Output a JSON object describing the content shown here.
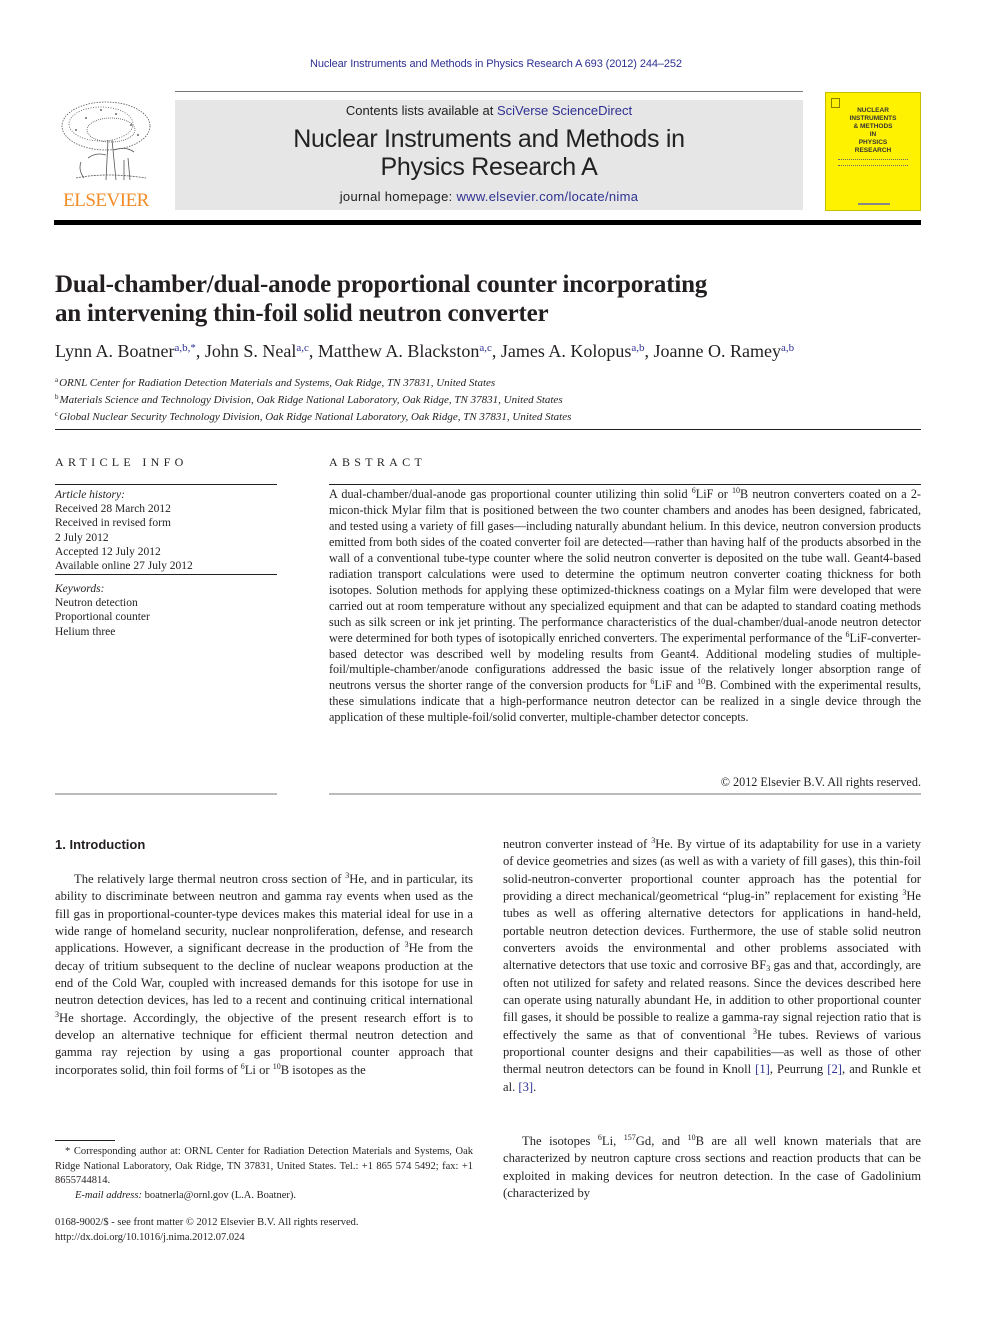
{
  "header": {
    "citation": "Nuclear Instruments and Methods in Physics Research A 693 (2012) 244–252",
    "publisher_logo_text": "ELSEVIER",
    "contents_prefix": "Contents lists available at ",
    "contents_link": "SciVerse ScienceDirect",
    "journal_title": "Nuclear Instruments and Methods in Physics Research A",
    "homepage_prefix": "journal homepage: ",
    "homepage_link": "www.elsevier.com/locate/nima",
    "cover_title": "NUCLEAR\nINSTRUMENTS\n& METHODS\nIN\nPHYSICS\nRESEARCH",
    "colors": {
      "elsevier_orange": "#f28c28",
      "link_blue": "#2e3192",
      "cover_yellow": "#fff200",
      "banner_gray": "#e6e6e6"
    }
  },
  "article": {
    "title_line1": "Dual-chamber/dual-anode proportional counter incorporating",
    "title_line2": "an intervening thin-foil solid neutron converter",
    "authors": [
      {
        "name": "Lynn A. Boatner",
        "aff": "a,b,*"
      },
      {
        "name": "John S. Neal",
        "aff": "a,c"
      },
      {
        "name": "Matthew A. Blackston",
        "aff": "a,c"
      },
      {
        "name": "James A. Kolopus",
        "aff": "a,b"
      },
      {
        "name": "Joanne O. Ramey",
        "aff": "a,b"
      }
    ],
    "affiliations": [
      {
        "key": "a",
        "text": "ORNL Center for Radiation Detection Materials and Systems, Oak Ridge, TN 37831, United States"
      },
      {
        "key": "b",
        "text": "Materials Science and Technology Division, Oak Ridge National Laboratory, Oak Ridge, TN 37831, United States"
      },
      {
        "key": "c",
        "text": "Global Nuclear Security Technology Division, Oak Ridge National Laboratory, Oak Ridge, TN 37831, United States"
      }
    ]
  },
  "article_info": {
    "heading": "ARTICLE INFO",
    "history_label": "Article history:",
    "history": [
      "Received 28 March 2012",
      "Received in revised form",
      "2 July 2012",
      "Accepted 12 July 2012",
      "Available online 27 July 2012"
    ],
    "keywords_label": "Keywords:",
    "keywords": [
      "Neutron detection",
      "Proportional counter",
      "Helium three"
    ]
  },
  "abstract": {
    "heading": "ABSTRACT",
    "s1": "A dual-chamber/dual-anode gas proportional counter utilizing thin solid ",
    "s2": "LiF or ",
    "s3": "B neutron converters coated on a 2-micon-thick Mylar film that is positioned between the two counter chambers and anodes has been designed, fabricated, and tested using a variety of fill gases—including naturally abundant helium. In this device, neutron conversion products emitted from both sides of the coated converter foil are detected—rather than having half of the products absorbed in the wall of a conventional tube-type counter where the solid neutron converter is deposited on the tube wall. Geant4-based radiation transport calculations were used to determine the optimum neutron converter coating thickness for both isotopes. Solution methods for applying these optimized-thickness coatings on a Mylar film were developed that were carried out at room temperature without any specialized equipment and that can be adapted to standard coating methods such as silk screen or ink jet printing. The performance characteristics of the dual-chamber/dual-anode neutron detector were determined for both types of isotopically enriched converters. The experimental performance of the ",
    "s4": "LiF-converter-based detector was described well by modeling results from Geant4. Additional modeling studies of multiple-foil/multiple-chamber/anode configurations addressed the basic issue of the relatively longer absorption range of neutrons versus the shorter range of the conversion products for ",
    "s5": "LiF and ",
    "s6": "B. Combined with the experimental results, these simulations indicate that a high-performance neutron detector can be realized in a single device through the application of these multiple-foil/solid converter, multiple-chamber detector concepts.",
    "sup_6": "6",
    "sup_10": "10",
    "copyright": "© 2012 Elsevier B.V. All rights reserved."
  },
  "introduction": {
    "heading": "1.  Introduction",
    "p1_a": "The relatively large thermal neutron cross section of ",
    "p1_b": "He, and in particular, its ability to discriminate between neutron and gamma ray events when used as the fill gas in proportional-counter-type devices makes this material ideal for use in a wide range of homeland security, nuclear nonproliferation, defense, and research applications. However, a significant decrease in the production of ",
    "p1_c": "He from the decay of tritium subsequent to the decline of nuclear weapons production at the end of the Cold War, coupled with increased demands for this isotope for use in neutron detection devices, has led to a recent and continuing critical international ",
    "p1_d": "He shortage. Accordingly, the objective of the present research effort is to develop an alternative technique for efficient thermal neutron detection and gamma ray rejection by using a gas proportional counter approach that incorporates solid, thin foil forms of ",
    "p1_e": "Li or ",
    "p1_f": "B isotopes as the",
    "p2_a": "neutron converter instead of ",
    "p2_b": "He. By virtue of its adaptability for use in a variety of device geometries and sizes (as well as with a variety of fill gases), this thin-foil solid-neutron-converter proportional counter approach has the potential for providing a direct mechanical/geometrical “plug-in” replacement for existing ",
    "p2_c": "He tubes as well as offering alternative detectors for applications in hand-held, portable neutron detection devices. Furthermore, the use of stable solid neutron converters avoids the environmental and other problems associated with alternative detectors that use toxic and corrosive BF",
    "p2_sub3": "3",
    "p2_d": " gas and that, accordingly, are often not utilized for safety and related reasons. Since the devices described here can operate using naturally abundant He, in addition to other proportional counter fill gases, it should be possible to realize a gamma-ray signal rejection ratio that is effectively the same as that of conventional ",
    "p2_e": "He tubes. Reviews of various proportional counter designs and their capabilities—as well as those of other thermal neutron detectors can be found in Knoll ",
    "ref1": "[1]",
    "p2_f": ", Peurrung ",
    "ref2": "[2]",
    "p2_g": ", and Runkle et al. ",
    "ref3": "[3]",
    "p2_h": ".",
    "p3_a": "The isotopes ",
    "p3_b": "Li, ",
    "p3_c": "Gd, and ",
    "p3_d": "B are all well known materials that are characterized by neutron capture cross sections and reaction products that can be exploited in making devices for neutron detection. In the case of Gadolinium (characterized by",
    "sup_3": "3",
    "sup_6": "6",
    "sup_10": "10",
    "sup_157": "157"
  },
  "footnotes": {
    "corresponding": "* Corresponding author at: ORNL Center for Radiation Detection Materials and Systems, Oak Ridge National Laboratory, Oak Ridge, TN 37831, United States. Tel.: +1 865 574 5492; fax: +1 8655744814.",
    "email_label": "E-mail address:",
    "email": "boatnerla@ornl.gov",
    "email_suffix": " (L.A. Boatner).",
    "issn_line": "0168-9002/$ - see front matter © 2012 Elsevier B.V. All rights reserved.",
    "doi": "http://dx.doi.org/10.1016/j.nima.2012.07.024"
  }
}
